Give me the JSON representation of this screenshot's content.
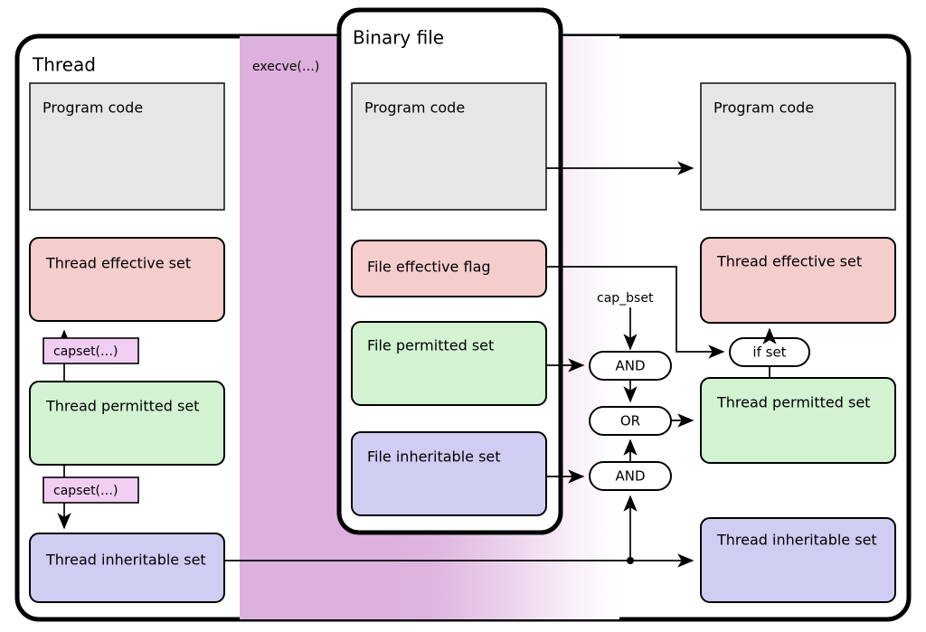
{
  "diagram": {
    "title_thread_panel": "Thread",
    "title_binary_panel": "Binary file",
    "transition_label": "execve(…)",
    "colors": {
      "effective_pink": "#f5cdcd",
      "permitted_green": "#d2f2d2",
      "inheritable_lavender": "#cfcdf2",
      "code_gray": "#e6e6e6",
      "capset_purple": "#f2cdf2",
      "band_purple": "#ddb0dd",
      "stroke_black": "#000000",
      "page_white": "#ffffff"
    }
  },
  "thread_panel": {
    "title": "Thread",
    "boxes": [
      {
        "id": "program-code",
        "label": "Program code"
      },
      {
        "id": "thread-effective-set",
        "label": "Thread effective set"
      },
      {
        "id": "thread-permitted-set",
        "label": "Thread permitted set"
      },
      {
        "id": "thread-inheritable-set",
        "label": "Thread inheritable set"
      }
    ],
    "capset_upper": "capset(…)",
    "capset_lower": "capset(…)"
  },
  "binary_panel": {
    "title": "Binary file",
    "boxes": [
      {
        "id": "program-code",
        "label": "Program code"
      },
      {
        "id": "file-effective-flag",
        "label": "File effective flag"
      },
      {
        "id": "file-permitted-set",
        "label": "File permitted set"
      },
      {
        "id": "file-inheritable-set",
        "label": "File inheritable set"
      }
    ]
  },
  "logic": {
    "cap_bset_label": "cap_bset",
    "and_upper": "AND",
    "or_gate": "OR",
    "and_lower": "AND",
    "if_set": "if set"
  },
  "result_panel": {
    "boxes": [
      {
        "id": "program-code",
        "label": "Program code"
      },
      {
        "id": "thread-effective-set",
        "label": "Thread effective set"
      },
      {
        "id": "thread-permitted-set",
        "label": "Thread permitted set"
      },
      {
        "id": "thread-inheritable-set",
        "label": "Thread inheritable set"
      }
    ]
  }
}
